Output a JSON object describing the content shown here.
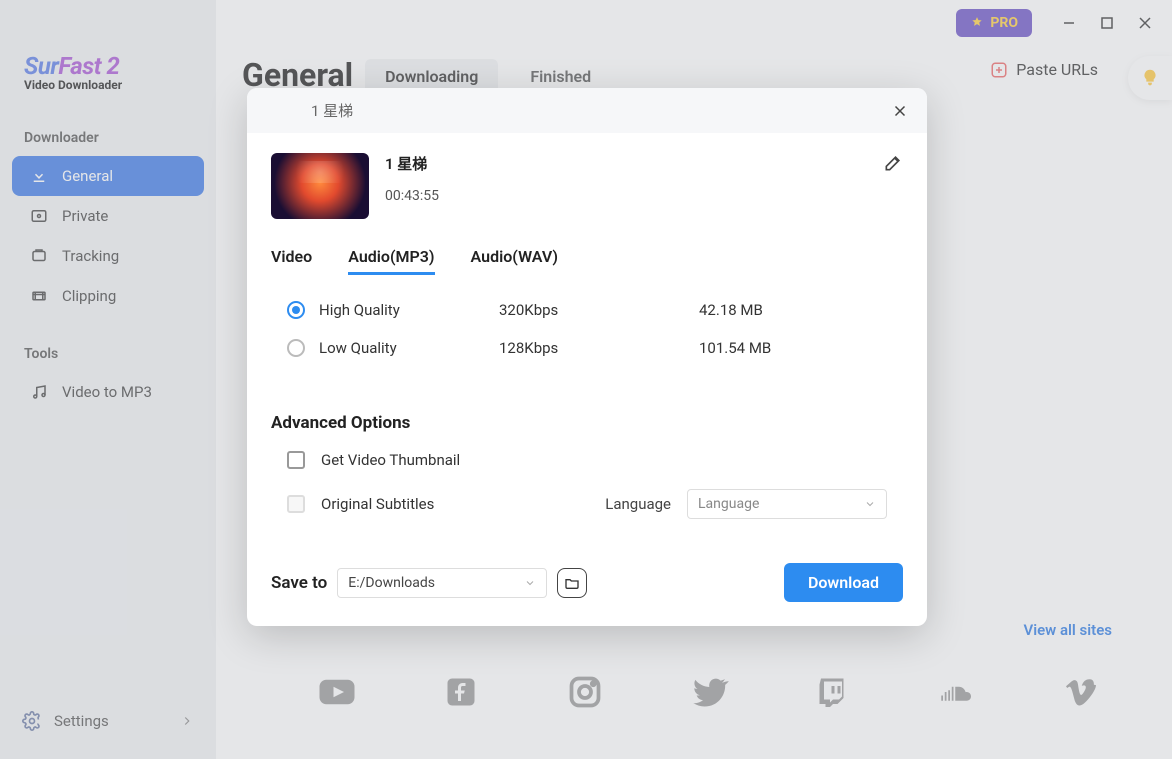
{
  "app": {
    "logo_line1_a": "Sur",
    "logo_line1_b": "Fast",
    "logo_line1_c": " 2",
    "logo_line2": "Video Downloader",
    "pro_label": "PRO"
  },
  "sidebar": {
    "section1": "Downloader",
    "section2": "Tools",
    "items": [
      {
        "label": "General"
      },
      {
        "label": "Private"
      },
      {
        "label": "Tracking"
      },
      {
        "label": "Clipping"
      }
    ],
    "tools": [
      {
        "label": "Video to MP3"
      }
    ],
    "settings": "Settings"
  },
  "header": {
    "title": "General",
    "tabs": [
      "Downloading",
      "Finished"
    ],
    "paste_label": "Paste URLs"
  },
  "sites": {
    "view_all": "View all sites"
  },
  "modal": {
    "header": "1 星梯",
    "video_title": "1 星梯",
    "duration": "00:43:55",
    "format_tabs": [
      "Video",
      "Audio(MP3)",
      "Audio(WAV)"
    ],
    "qualities": [
      {
        "label": "High Quality",
        "rate": "320Kbps",
        "size": "42.18 MB",
        "selected": true
      },
      {
        "label": "Low Quality",
        "rate": "128Kbps",
        "size": "101.54 MB",
        "selected": false
      }
    ],
    "advanced_title": "Advanced Options",
    "thumb_label": "Get Video Thumbnail",
    "subs_label": "Original Subtitles",
    "lang_label": "Language",
    "lang_select": "Language",
    "save_to": "Save to",
    "save_path": "E:/Downloads",
    "download": "Download"
  }
}
